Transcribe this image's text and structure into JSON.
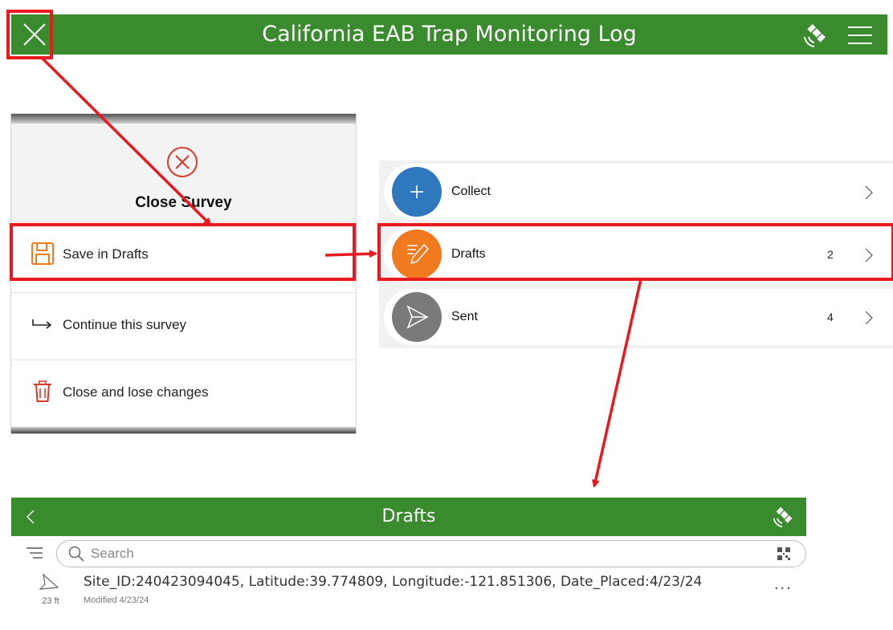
{
  "top_bar": {
    "title": "California EAB Trap Monitoring  Log",
    "color": "#3a8a2e",
    "icons": [
      "close-icon",
      "satellite-icon",
      "hamburger-menu-icon"
    ]
  },
  "close_dialog": {
    "title": "Close Survey",
    "items": [
      {
        "label": "Save in Drafts",
        "icon": "save-icon"
      },
      {
        "label": "Continue this survey",
        "icon": "continue-arrow-icon"
      },
      {
        "label": "Close and lose changes",
        "icon": "trash-icon"
      }
    ]
  },
  "survey_menu": {
    "items": [
      {
        "label": "Collect",
        "count": "",
        "color": "#2f78bf",
        "icon": "plus-icon"
      },
      {
        "label": "Drafts",
        "count": "2",
        "color": "#f07a1d",
        "icon": "draft-pencil-icon"
      },
      {
        "label": "Sent",
        "count": "4",
        "color": "#7a7a7a",
        "icon": "send-icon"
      }
    ]
  },
  "drafts_screen": {
    "title": "Drafts",
    "search_placeholder": "Search",
    "entries": [
      {
        "title": "Site_ID:240423094045, Latitude:39.774809, Longitude:-121.851306, Date_Placed:4/23/24",
        "modified": "Modified 4/23/24",
        "distance": "23 ft",
        "more": "..."
      }
    ]
  },
  "annotation_color": "#e8191f"
}
